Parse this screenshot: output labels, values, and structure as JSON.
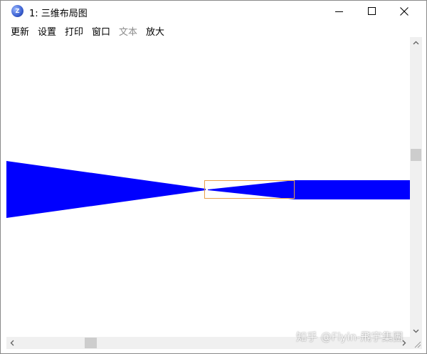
{
  "window": {
    "title": "1: 三维布局图",
    "icon": "app-logo-icon",
    "icon_text": "Z"
  },
  "menu": [
    {
      "label": "更新",
      "enabled": true
    },
    {
      "label": "设置",
      "enabled": true
    },
    {
      "label": "打印",
      "enabled": true
    },
    {
      "label": "窗口",
      "enabled": true
    },
    {
      "label": "文本",
      "enabled": false
    },
    {
      "label": "放大",
      "enabled": true
    }
  ],
  "colors": {
    "shape_fill": "#0000ff",
    "selection_box": "#e8a04a",
    "scrollbar_track": "#f0f0f0",
    "scrollbar_thumb": "#cdcdcd"
  },
  "watermark": "知乎 @Flyin-飛宇集團"
}
